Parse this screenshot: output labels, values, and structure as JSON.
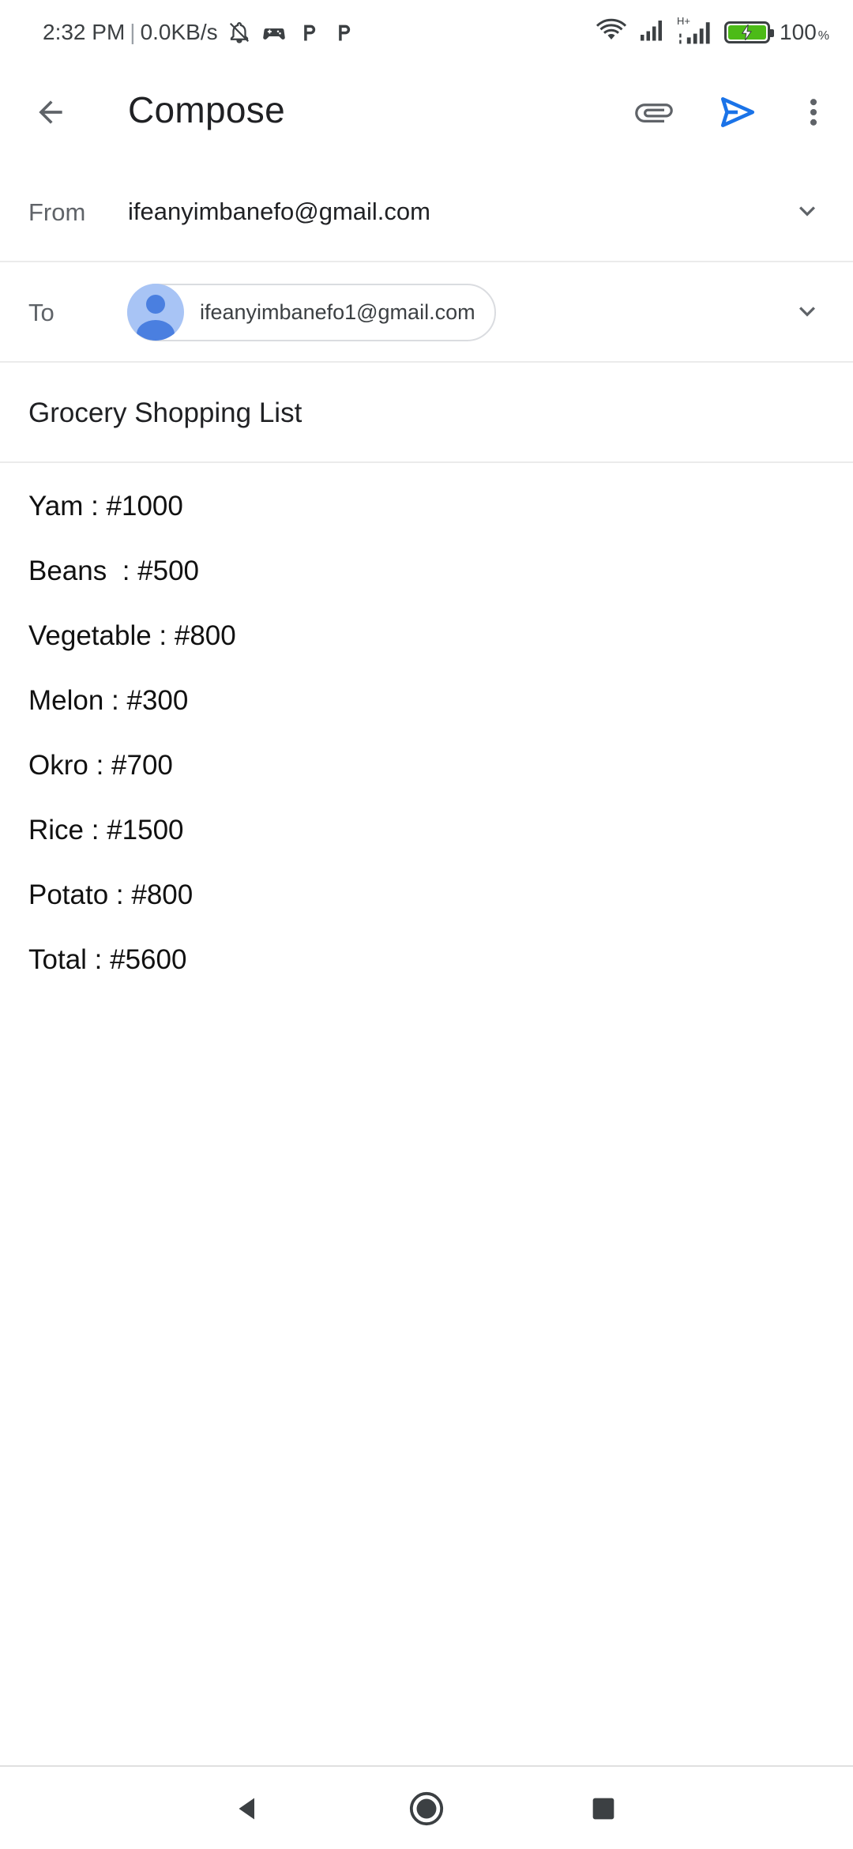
{
  "status_bar": {
    "time": "2:32 PM",
    "speed": "0.0KB/s",
    "network_type": "H+",
    "battery_percent": "100",
    "battery_suffix": "%",
    "icons": [
      "bell-off-icon",
      "game-controller-icon",
      "p-icon",
      "p-icon",
      "wifi-icon",
      "signal-icon",
      "signal-h-plus-icon",
      "battery-charging-icon"
    ]
  },
  "toolbar": {
    "title": "Compose",
    "icons": [
      "back-arrow-icon",
      "attach-icon",
      "send-icon",
      "more-vert-icon"
    ]
  },
  "from": {
    "label": "From",
    "value": "ifeanyimbanefo@gmail.com"
  },
  "to": {
    "label": "To",
    "recipient": "ifeanyimbanefo1@gmail.com"
  },
  "subject": "Grocery Shopping List",
  "body_lines": [
    "Yam : #1000",
    "Beans  : #500",
    "Vegetable : #800",
    "Melon : #300",
    "Okro : #700",
    "Rice : #1500",
    "Potato : #800",
    "Total : #5600"
  ],
  "colors": {
    "accent": "#1a73e8",
    "avatar_bg": "#a8c4f5",
    "avatar_fg": "#4a7fe0",
    "battery": "#4cbb17"
  },
  "nav_bar": {
    "icons": [
      "nav-back-icon",
      "nav-home-icon",
      "nav-recents-icon"
    ]
  }
}
